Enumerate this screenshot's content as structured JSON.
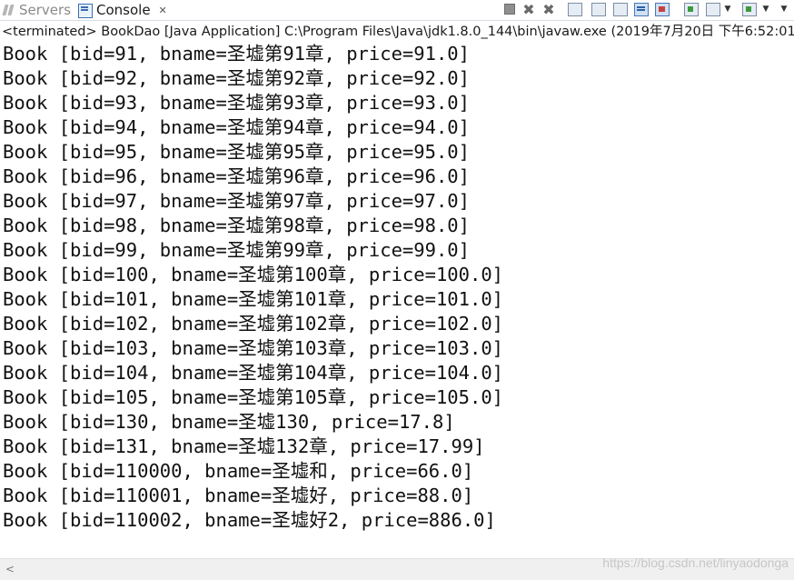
{
  "tabs": {
    "servers_label": "Servers",
    "console_label": "Console",
    "close_symbol": "✕"
  },
  "toolbar": {
    "icons": [
      "terminate-icon",
      "remove-launch-icon",
      "remove-all-icon",
      "clear-console-icon",
      "scroll-lock-icon",
      "word-wrap-icon",
      "show-on-stdout-icon",
      "show-on-stderr-icon",
      "pin-console-icon",
      "display-selected-console-icon",
      "open-console-icon",
      "view-menu-icon"
    ]
  },
  "status_line": "<terminated> BookDao [Java Application] C:\\Program Files\\Java\\jdk1.8.0_144\\bin\\javaw.exe (2019年7月20日 下午6:52:01)",
  "console_lines": [
    "Book [bid=91, bname=圣墟第91章, price=91.0]",
    "Book [bid=92, bname=圣墟第92章, price=92.0]",
    "Book [bid=93, bname=圣墟第93章, price=93.0]",
    "Book [bid=94, bname=圣墟第94章, price=94.0]",
    "Book [bid=95, bname=圣墟第95章, price=95.0]",
    "Book [bid=96, bname=圣墟第96章, price=96.0]",
    "Book [bid=97, bname=圣墟第97章, price=97.0]",
    "Book [bid=98, bname=圣墟第98章, price=98.0]",
    "Book [bid=99, bname=圣墟第99章, price=99.0]",
    "Book [bid=100, bname=圣墟第100章, price=100.0]",
    "Book [bid=101, bname=圣墟第101章, price=101.0]",
    "Book [bid=102, bname=圣墟第102章, price=102.0]",
    "Book [bid=103, bname=圣墟第103章, price=103.0]",
    "Book [bid=104, bname=圣墟第104章, price=104.0]",
    "Book [bid=105, bname=圣墟第105章, price=105.0]",
    "Book [bid=130, bname=圣墟130, price=17.8]",
    "Book [bid=131, bname=圣墟132章, price=17.99]",
    "Book [bid=110000, bname=圣墟和, price=66.0]",
    "Book [bid=110001, bname=圣墟好, price=88.0]",
    "Book [bid=110002, bname=圣墟好2, price=886.0]"
  ],
  "scrollbar": {
    "left_arrow": "<"
  },
  "watermark": "https://blog.csdn.net/linyaodonga"
}
